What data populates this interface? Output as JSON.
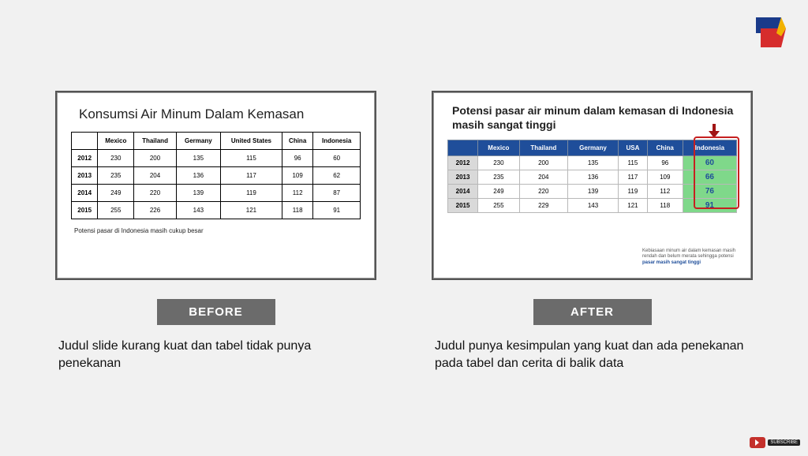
{
  "chart_data": [
    {
      "type": "table",
      "title": "Konsumsi Air Minum Dalam Kemasan",
      "columns": [
        "",
        "Mexico",
        "Thailand",
        "Germany",
        "United States",
        "China",
        "Indonesia"
      ],
      "rows": [
        [
          "2012",
          230,
          200,
          135,
          115,
          96,
          60
        ],
        [
          "2013",
          235,
          204,
          136,
          117,
          109,
          62
        ],
        [
          "2014",
          249,
          220,
          139,
          119,
          112,
          87
        ],
        [
          "2015",
          255,
          226,
          143,
          121,
          118,
          91
        ]
      ],
      "caption": "Potensi pasar di Indonesia masih cukup besar"
    },
    {
      "type": "table",
      "title": "Potensi pasar air minum dalam kemasan di Indonesia masih sangat tinggi",
      "columns": [
        "",
        "Mexico",
        "Thailand",
        "Germany",
        "USA",
        "China",
        "Indonesia"
      ],
      "rows": [
        [
          "2012",
          230,
          200,
          135,
          115,
          96,
          60
        ],
        [
          "2013",
          235,
          204,
          136,
          117,
          109,
          66
        ],
        [
          "2014",
          249,
          220,
          139,
          119,
          112,
          76
        ],
        [
          "2015",
          255,
          229,
          143,
          121,
          118,
          91
        ]
      ],
      "highlight_column": "Indonesia",
      "note_plain": "Kebiasaan minum air dalam kemasan masih rendah dan belum merata sehingga potensi",
      "note_emph": "pasar masih sangat tinggi"
    }
  ],
  "labels": {
    "before": "BEFORE",
    "after": "AFTER"
  },
  "descriptions": {
    "before": "Judul slide kurang kuat dan tabel tidak punya penekanan",
    "after": "Judul punya kesimpulan yang kuat dan ada penekanan pada tabel dan cerita di balik data"
  },
  "youtube_label": "SUBSCRIBE"
}
